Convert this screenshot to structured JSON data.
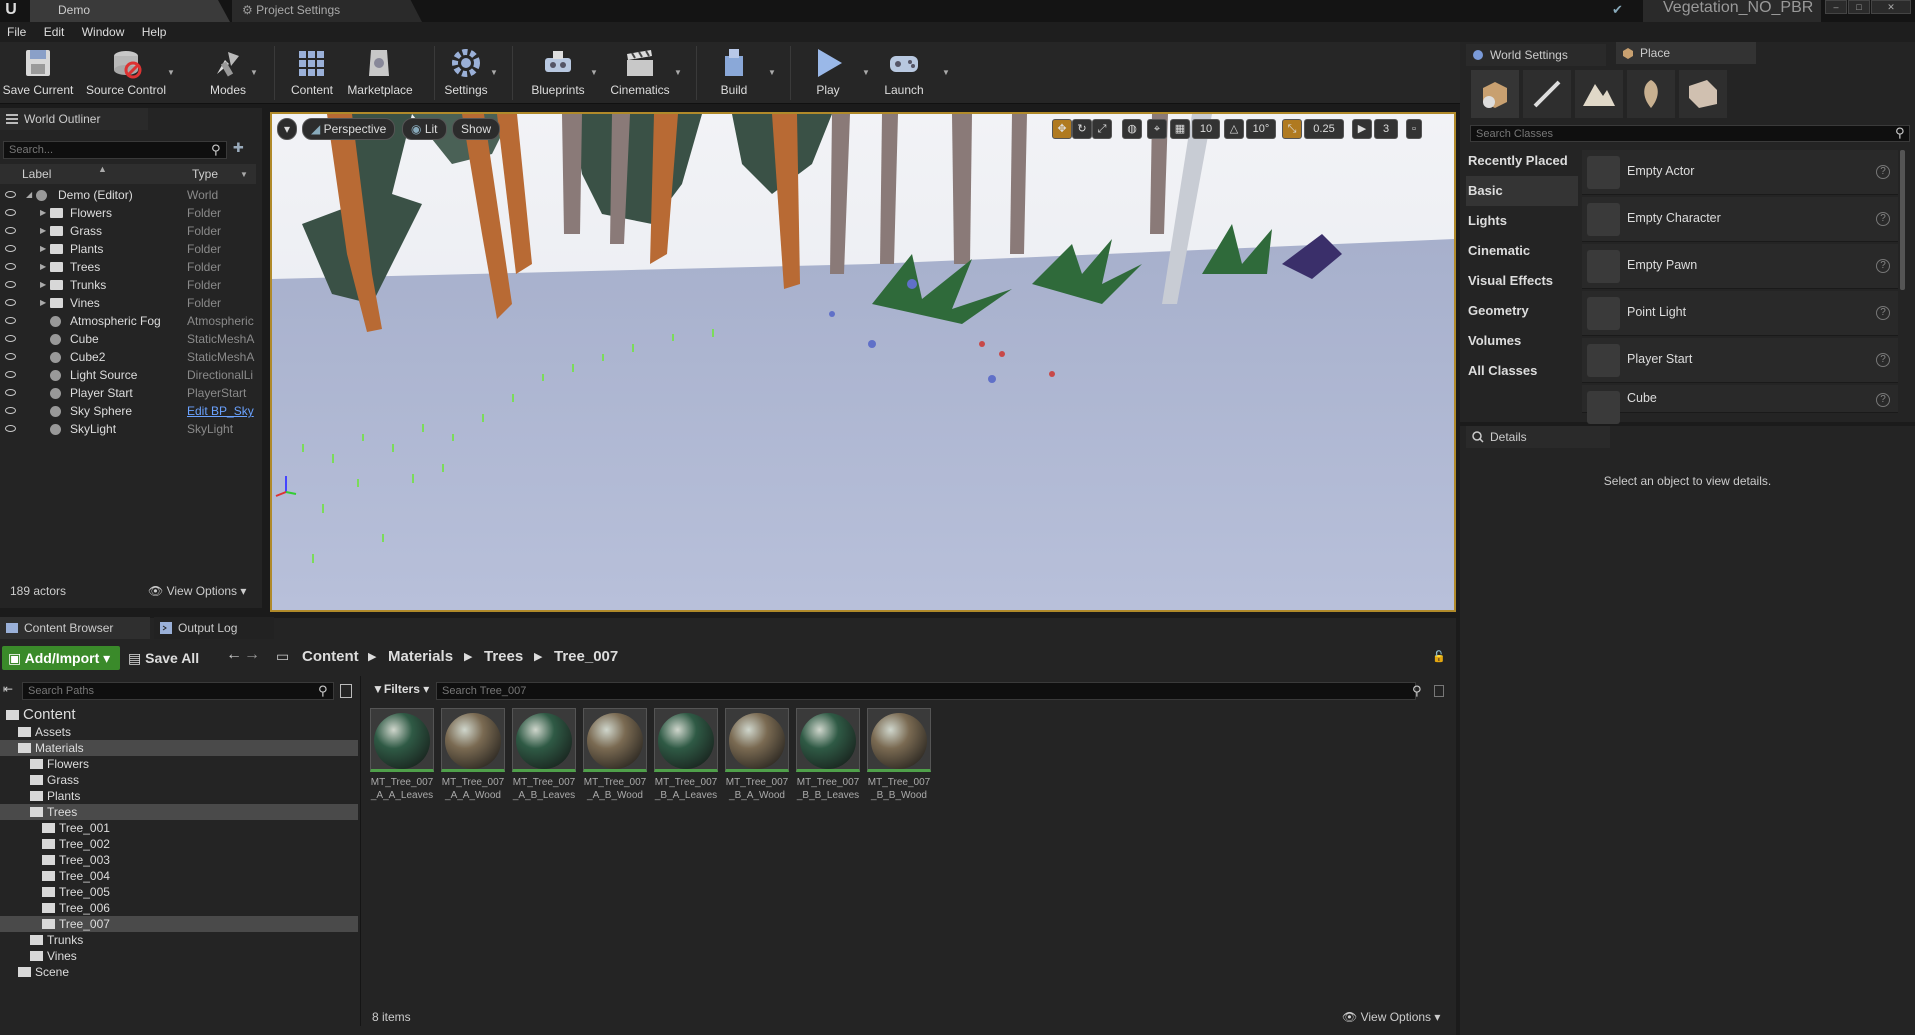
{
  "title_bar": {
    "tabs": [
      "Demo",
      "Project Settings"
    ],
    "project_name": "Vegetation_NO_PBR"
  },
  "menu": [
    "File",
    "Edit",
    "Window",
    "Help"
  ],
  "toolbar": {
    "items": [
      "Save Current",
      "Source Control",
      "Modes",
      "Content",
      "Marketplace",
      "Settings",
      "Blueprints",
      "Cinematics",
      "Build",
      "Play",
      "Launch"
    ]
  },
  "world_outliner": {
    "tab": "World Outliner",
    "search_placeholder": "Search...",
    "col_label": "Label",
    "col_type": "Type",
    "rows": [
      {
        "label": "Demo (Editor)",
        "type": "World"
      },
      {
        "label": "Flowers",
        "type": "Folder"
      },
      {
        "label": "Grass",
        "type": "Folder"
      },
      {
        "label": "Plants",
        "type": "Folder"
      },
      {
        "label": "Trees",
        "type": "Folder"
      },
      {
        "label": "Trunks",
        "type": "Folder"
      },
      {
        "label": "Vines",
        "type": "Folder"
      },
      {
        "label": "Atmospheric Fog",
        "type": "Atmospheric"
      },
      {
        "label": "Cube",
        "type": "StaticMeshA"
      },
      {
        "label": "Cube2",
        "type": "StaticMeshA"
      },
      {
        "label": "Light Source",
        "type": "DirectionalLi"
      },
      {
        "label": "Player Start",
        "type": "PlayerStart"
      },
      {
        "label": "Sky Sphere",
        "type": "Edit BP_Sky"
      },
      {
        "label": "SkyLight",
        "type": "SkyLight"
      }
    ],
    "actor_count": "189 actors",
    "view_options": "View Options"
  },
  "viewport": {
    "perspective": "Perspective",
    "lit": "Lit",
    "show": "Show",
    "grid_snap": "10",
    "rot_snap": "10°",
    "scale_snap": "0.25",
    "cam_speed": "3"
  },
  "right_panel": {
    "tab_world_settings": "World Settings",
    "tab_place": "Place",
    "search_placeholder": "Search Classes",
    "categories": [
      "Recently Placed",
      "Basic",
      "Lights",
      "Cinematic",
      "Visual Effects",
      "Geometry",
      "Volumes",
      "All Classes"
    ],
    "items": [
      "Empty Actor",
      "Empty Character",
      "Empty Pawn",
      "Point Light",
      "Player Start",
      "Cube"
    ],
    "details_tab": "Details",
    "details_message": "Select an object to view details."
  },
  "content_browser": {
    "tab": "Content Browser",
    "tab_output": "Output Log",
    "add_import": "Add/Import",
    "save_all": "Save All",
    "breadcrumb": [
      "Content",
      "Materials",
      "Trees",
      "Tree_007"
    ],
    "search_paths_placeholder": "Search Paths",
    "filters": "Filters",
    "search_placeholder": "Search Tree_007",
    "tree": [
      {
        "label": "Content",
        "level": 0,
        "big": true
      },
      {
        "label": "Assets",
        "level": 1
      },
      {
        "label": "Materials",
        "level": 1,
        "sel": true
      },
      {
        "label": "Flowers",
        "level": 2
      },
      {
        "label": "Grass",
        "level": 2
      },
      {
        "label": "Plants",
        "level": 2
      },
      {
        "label": "Trees",
        "level": 2,
        "sel": true
      },
      {
        "label": "Tree_001",
        "level": 3
      },
      {
        "label": "Tree_002",
        "level": 3
      },
      {
        "label": "Tree_003",
        "level": 3
      },
      {
        "label": "Tree_004",
        "level": 3
      },
      {
        "label": "Tree_005",
        "level": 3
      },
      {
        "label": "Tree_006",
        "level": 3
      },
      {
        "label": "Tree_007",
        "level": 3,
        "sel": true
      },
      {
        "label": "Trunks",
        "level": 2
      },
      {
        "label": "Vines",
        "level": 2
      },
      {
        "label": "Scene",
        "level": 1
      }
    ],
    "assets": [
      {
        "line1": "MT_Tree_007",
        "line2": "_A_A_Leaves",
        "color": "#2f5a45"
      },
      {
        "line1": "MT_Tree_007",
        "line2": "_A_A_Wood",
        "color": "#7a6a52"
      },
      {
        "line1": "MT_Tree_007",
        "line2": "_A_B_Leaves",
        "color": "#2f5a45"
      },
      {
        "line1": "MT_Tree_007",
        "line2": "_A_B_Wood",
        "color": "#7a6a52"
      },
      {
        "line1": "MT_Tree_007",
        "line2": "_B_A_Leaves",
        "color": "#2f5a45"
      },
      {
        "line1": "MT_Tree_007",
        "line2": "_B_A_Wood",
        "color": "#7a6a52"
      },
      {
        "line1": "MT_Tree_007",
        "line2": "_B_B_Leaves",
        "color": "#2f5a45"
      },
      {
        "line1": "MT_Tree_007",
        "line2": "_B_B_Wood",
        "color": "#7a6a52"
      }
    ],
    "item_count": "8 items",
    "view_options": "View Options"
  }
}
